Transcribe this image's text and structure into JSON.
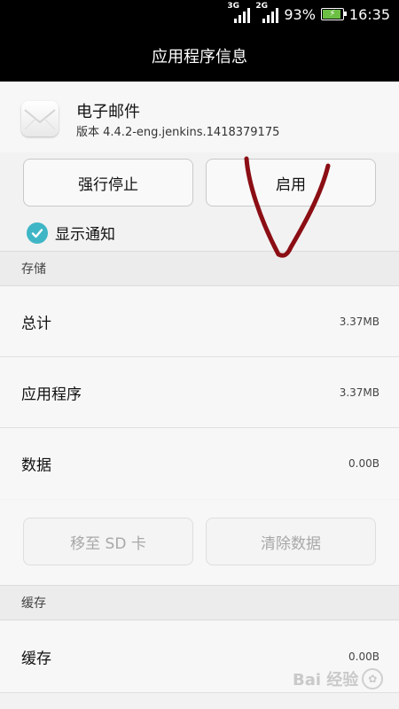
{
  "status_bar": {
    "sim1_network": "3G",
    "sim2_network": "2G",
    "battery_percent": "93%",
    "battery_level": 0.93,
    "time": "16:35"
  },
  "title_bar": {
    "title": "应用程序信息"
  },
  "app": {
    "name": "电子邮件",
    "version": "版本 4.4.2-eng.jenkins.1418379175",
    "icon": "mail-envelope-icon"
  },
  "actions": {
    "force_stop_label": "强行停止",
    "enable_label": "启用"
  },
  "notification": {
    "label": "显示通知",
    "checked": true
  },
  "storage": {
    "section_title": "存储",
    "rows": [
      {
        "label": "总计",
        "value": "3.37MB"
      },
      {
        "label": "应用程序",
        "value": "3.37MB"
      },
      {
        "label": "数据",
        "value": "0.00B"
      }
    ],
    "move_to_sd_label": "移至 SD 卡",
    "clear_data_label": "清除数据"
  },
  "cache": {
    "section_title": "缓存",
    "rows": [
      {
        "label": "缓存",
        "value": "0.00B"
      }
    ]
  },
  "watermark": {
    "text": "Bai 经验"
  },
  "colors": {
    "accent": "#3fb6c6",
    "annotation": "#8b0e14",
    "title_bar_bg": "#000000"
  }
}
